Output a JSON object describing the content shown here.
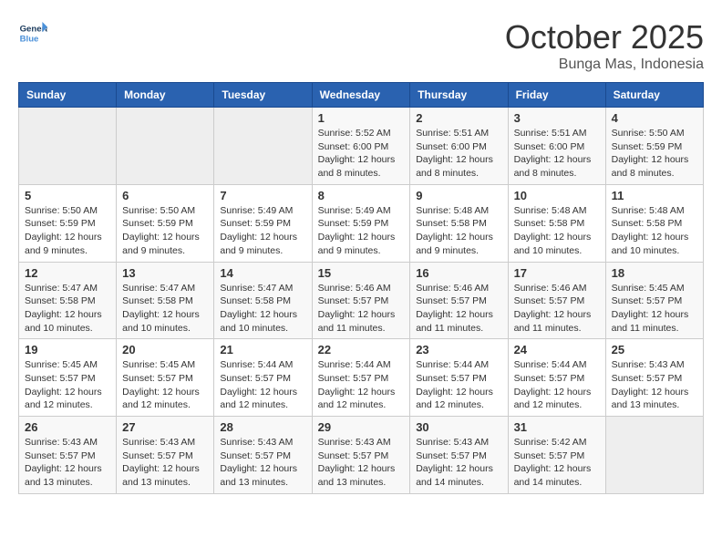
{
  "logo": {
    "line1": "General",
    "line2": "Blue"
  },
  "title": "October 2025",
  "location": "Bunga Mas, Indonesia",
  "weekdays": [
    "Sunday",
    "Monday",
    "Tuesday",
    "Wednesday",
    "Thursday",
    "Friday",
    "Saturday"
  ],
  "weeks": [
    [
      {
        "day": "",
        "sunrise": "",
        "sunset": "",
        "daylight": ""
      },
      {
        "day": "",
        "sunrise": "",
        "sunset": "",
        "daylight": ""
      },
      {
        "day": "",
        "sunrise": "",
        "sunset": "",
        "daylight": ""
      },
      {
        "day": "1",
        "sunrise": "Sunrise: 5:52 AM",
        "sunset": "Sunset: 6:00 PM",
        "daylight": "Daylight: 12 hours and 8 minutes."
      },
      {
        "day": "2",
        "sunrise": "Sunrise: 5:51 AM",
        "sunset": "Sunset: 6:00 PM",
        "daylight": "Daylight: 12 hours and 8 minutes."
      },
      {
        "day": "3",
        "sunrise": "Sunrise: 5:51 AM",
        "sunset": "Sunset: 6:00 PM",
        "daylight": "Daylight: 12 hours and 8 minutes."
      },
      {
        "day": "4",
        "sunrise": "Sunrise: 5:50 AM",
        "sunset": "Sunset: 5:59 PM",
        "daylight": "Daylight: 12 hours and 8 minutes."
      }
    ],
    [
      {
        "day": "5",
        "sunrise": "Sunrise: 5:50 AM",
        "sunset": "Sunset: 5:59 PM",
        "daylight": "Daylight: 12 hours and 9 minutes."
      },
      {
        "day": "6",
        "sunrise": "Sunrise: 5:50 AM",
        "sunset": "Sunset: 5:59 PM",
        "daylight": "Daylight: 12 hours and 9 minutes."
      },
      {
        "day": "7",
        "sunrise": "Sunrise: 5:49 AM",
        "sunset": "Sunset: 5:59 PM",
        "daylight": "Daylight: 12 hours and 9 minutes."
      },
      {
        "day": "8",
        "sunrise": "Sunrise: 5:49 AM",
        "sunset": "Sunset: 5:59 PM",
        "daylight": "Daylight: 12 hours and 9 minutes."
      },
      {
        "day": "9",
        "sunrise": "Sunrise: 5:48 AM",
        "sunset": "Sunset: 5:58 PM",
        "daylight": "Daylight: 12 hours and 9 minutes."
      },
      {
        "day": "10",
        "sunrise": "Sunrise: 5:48 AM",
        "sunset": "Sunset: 5:58 PM",
        "daylight": "Daylight: 12 hours and 10 minutes."
      },
      {
        "day": "11",
        "sunrise": "Sunrise: 5:48 AM",
        "sunset": "Sunset: 5:58 PM",
        "daylight": "Daylight: 12 hours and 10 minutes."
      }
    ],
    [
      {
        "day": "12",
        "sunrise": "Sunrise: 5:47 AM",
        "sunset": "Sunset: 5:58 PM",
        "daylight": "Daylight: 12 hours and 10 minutes."
      },
      {
        "day": "13",
        "sunrise": "Sunrise: 5:47 AM",
        "sunset": "Sunset: 5:58 PM",
        "daylight": "Daylight: 12 hours and 10 minutes."
      },
      {
        "day": "14",
        "sunrise": "Sunrise: 5:47 AM",
        "sunset": "Sunset: 5:58 PM",
        "daylight": "Daylight: 12 hours and 10 minutes."
      },
      {
        "day": "15",
        "sunrise": "Sunrise: 5:46 AM",
        "sunset": "Sunset: 5:57 PM",
        "daylight": "Daylight: 12 hours and 11 minutes."
      },
      {
        "day": "16",
        "sunrise": "Sunrise: 5:46 AM",
        "sunset": "Sunset: 5:57 PM",
        "daylight": "Daylight: 12 hours and 11 minutes."
      },
      {
        "day": "17",
        "sunrise": "Sunrise: 5:46 AM",
        "sunset": "Sunset: 5:57 PM",
        "daylight": "Daylight: 12 hours and 11 minutes."
      },
      {
        "day": "18",
        "sunrise": "Sunrise: 5:45 AM",
        "sunset": "Sunset: 5:57 PM",
        "daylight": "Daylight: 12 hours and 11 minutes."
      }
    ],
    [
      {
        "day": "19",
        "sunrise": "Sunrise: 5:45 AM",
        "sunset": "Sunset: 5:57 PM",
        "daylight": "Daylight: 12 hours and 12 minutes."
      },
      {
        "day": "20",
        "sunrise": "Sunrise: 5:45 AM",
        "sunset": "Sunset: 5:57 PM",
        "daylight": "Daylight: 12 hours and 12 minutes."
      },
      {
        "day": "21",
        "sunrise": "Sunrise: 5:44 AM",
        "sunset": "Sunset: 5:57 PM",
        "daylight": "Daylight: 12 hours and 12 minutes."
      },
      {
        "day": "22",
        "sunrise": "Sunrise: 5:44 AM",
        "sunset": "Sunset: 5:57 PM",
        "daylight": "Daylight: 12 hours and 12 minutes."
      },
      {
        "day": "23",
        "sunrise": "Sunrise: 5:44 AM",
        "sunset": "Sunset: 5:57 PM",
        "daylight": "Daylight: 12 hours and 12 minutes."
      },
      {
        "day": "24",
        "sunrise": "Sunrise: 5:44 AM",
        "sunset": "Sunset: 5:57 PM",
        "daylight": "Daylight: 12 hours and 12 minutes."
      },
      {
        "day": "25",
        "sunrise": "Sunrise: 5:43 AM",
        "sunset": "Sunset: 5:57 PM",
        "daylight": "Daylight: 12 hours and 13 minutes."
      }
    ],
    [
      {
        "day": "26",
        "sunrise": "Sunrise: 5:43 AM",
        "sunset": "Sunset: 5:57 PM",
        "daylight": "Daylight: 12 hours and 13 minutes."
      },
      {
        "day": "27",
        "sunrise": "Sunrise: 5:43 AM",
        "sunset": "Sunset: 5:57 PM",
        "daylight": "Daylight: 12 hours and 13 minutes."
      },
      {
        "day": "28",
        "sunrise": "Sunrise: 5:43 AM",
        "sunset": "Sunset: 5:57 PM",
        "daylight": "Daylight: 12 hours and 13 minutes."
      },
      {
        "day": "29",
        "sunrise": "Sunrise: 5:43 AM",
        "sunset": "Sunset: 5:57 PM",
        "daylight": "Daylight: 12 hours and 13 minutes."
      },
      {
        "day": "30",
        "sunrise": "Sunrise: 5:43 AM",
        "sunset": "Sunset: 5:57 PM",
        "daylight": "Daylight: 12 hours and 14 minutes."
      },
      {
        "day": "31",
        "sunrise": "Sunrise: 5:42 AM",
        "sunset": "Sunset: 5:57 PM",
        "daylight": "Daylight: 12 hours and 14 minutes."
      },
      {
        "day": "",
        "sunrise": "",
        "sunset": "",
        "daylight": ""
      }
    ]
  ]
}
